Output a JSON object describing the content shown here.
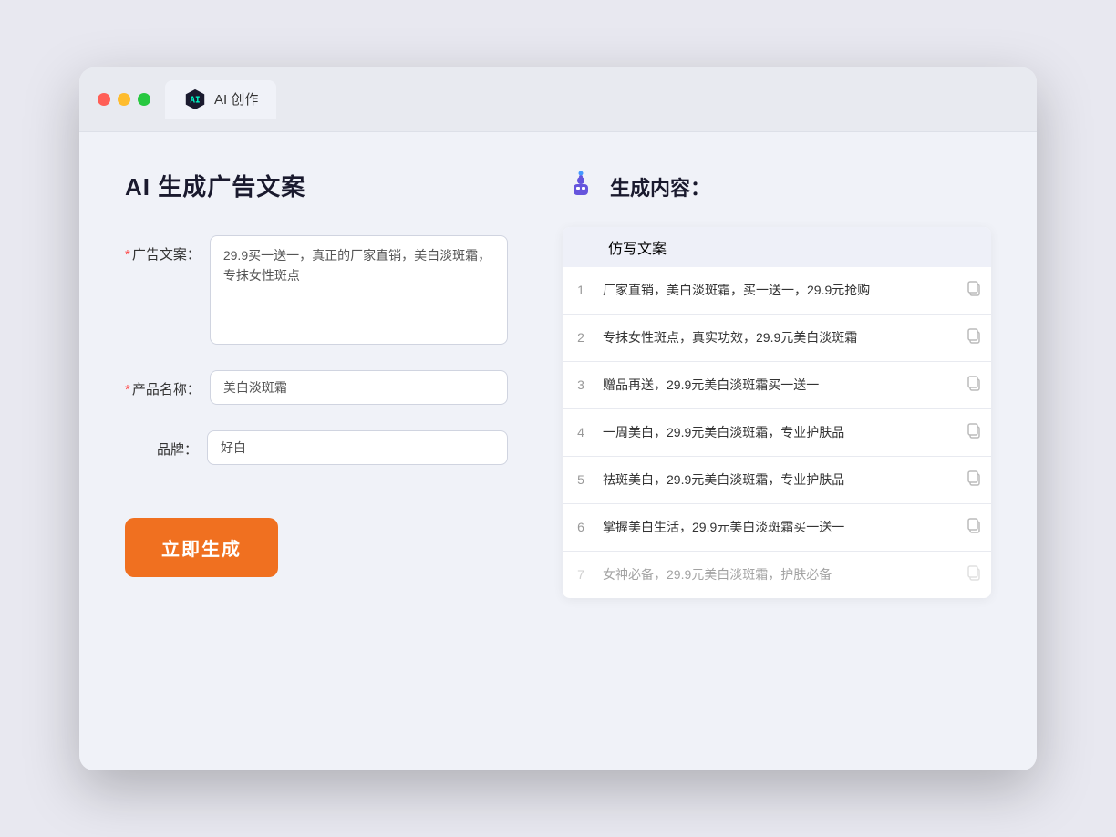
{
  "window": {
    "tab_label": "AI 创作"
  },
  "left_panel": {
    "title": "AI 生成广告文案",
    "fields": [
      {
        "label": "广告文案：",
        "required": true,
        "type": "textarea",
        "value": "29.9买一送一，真正的厂家直销，美白淡斑霜，专抹女性斑点"
      },
      {
        "label": "产品名称：",
        "required": true,
        "type": "input",
        "value": "美白淡斑霜"
      },
      {
        "label": "品牌：",
        "required": false,
        "type": "input",
        "value": "好白"
      }
    ],
    "generate_button": "立即生成"
  },
  "right_panel": {
    "title": "生成内容：",
    "column_header": "仿写文案",
    "results": [
      {
        "num": 1,
        "text": "厂家直销，美白淡斑霜，买一送一，29.9元抢购",
        "faded": false
      },
      {
        "num": 2,
        "text": "专抹女性斑点，真实功效，29.9元美白淡斑霜",
        "faded": false
      },
      {
        "num": 3,
        "text": "赠品再送，29.9元美白淡斑霜买一送一",
        "faded": false
      },
      {
        "num": 4,
        "text": "一周美白，29.9元美白淡斑霜，专业护肤品",
        "faded": false
      },
      {
        "num": 5,
        "text": "祛斑美白，29.9元美白淡斑霜，专业护肤品",
        "faded": false
      },
      {
        "num": 6,
        "text": "掌握美白生活，29.9元美白淡斑霜买一送一",
        "faded": false
      },
      {
        "num": 7,
        "text": "女神必备，29.9元美白淡斑霜，护肤必备",
        "faded": true
      }
    ]
  }
}
